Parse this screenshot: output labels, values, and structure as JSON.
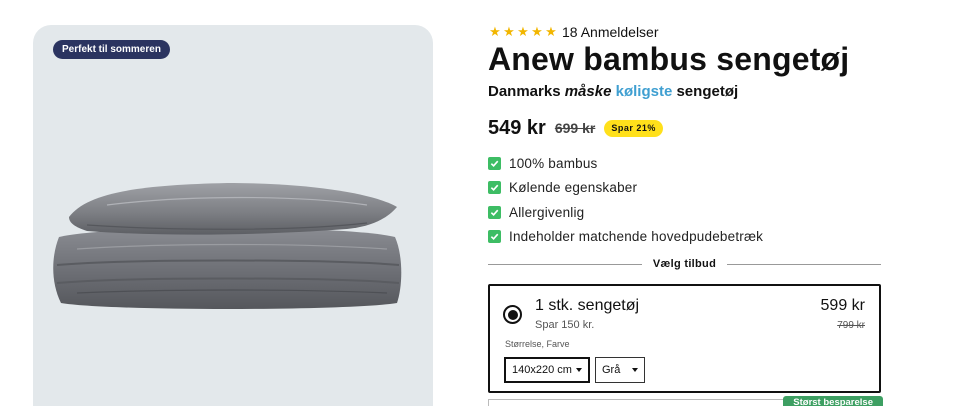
{
  "gallery": {
    "badge": "Perfekt til sommeren"
  },
  "product": {
    "rating_count_text": "18 Anmeldelser",
    "stars": 5,
    "title": "Anew bambus sengetøj",
    "subtitle": {
      "part1": "Danmarks",
      "emphasis": "måske",
      "accent": "køligste",
      "part2": "sengetøj"
    },
    "price": "549 kr",
    "old_price": "699 kr",
    "save_badge": "Spar 21%",
    "features": [
      "100% bambus",
      "Kølende egenskaber",
      "Allergivenlig",
      "Indeholder matchende hovedpudebetræk"
    ]
  },
  "offers": {
    "heading": "Vælg tilbud",
    "selected": {
      "title": "1 stk. sengetøj",
      "save": "Spar 150 kr.",
      "price": "599 kr",
      "old_price": "799 kr",
      "options_label": "Størrelse, Farve",
      "size_value": "140x220 cm",
      "color_value": "Grå"
    },
    "next_ribbon": "Størst besparelse"
  },
  "colors": {
    "badge_bg": "#2b3460",
    "accent_blue": "#3f9fd1",
    "star": "#f2b600",
    "save_yellow": "#ffe01b",
    "check_green": "#3dbd64",
    "ribbon_green": "#3d9f62"
  }
}
